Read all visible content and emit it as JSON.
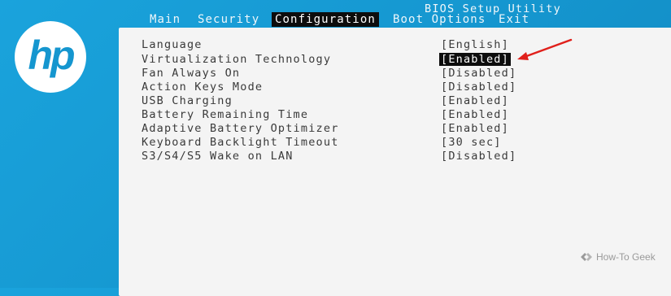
{
  "header": {
    "title": "BIOS Setup Utility"
  },
  "logo": {
    "text": "hp"
  },
  "tabs": [
    {
      "label": "Main",
      "active": false
    },
    {
      "label": "Security",
      "active": false
    },
    {
      "label": "Configuration",
      "active": true
    },
    {
      "label": "Boot Options",
      "active": false
    },
    {
      "label": "Exit",
      "active": false
    }
  ],
  "settings": [
    {
      "label": "Language",
      "value": "[English]",
      "selected": false
    },
    {
      "label": "Virtualization Technology",
      "value": "[Enabled]",
      "selected": true
    },
    {
      "label": "Fan Always On",
      "value": "[Disabled]",
      "selected": false
    },
    {
      "label": "Action Keys Mode",
      "value": "[Disabled]",
      "selected": false
    },
    {
      "label": "USB Charging",
      "value": "[Enabled]",
      "selected": false
    },
    {
      "label": "Battery Remaining Time",
      "value": "[Enabled]",
      "selected": false
    },
    {
      "label": "Adaptive Battery Optimizer",
      "value": "[Enabled]",
      "selected": false
    },
    {
      "label": "Keyboard Backlight Timeout",
      "value": "[30 sec]",
      "selected": false
    },
    {
      "label": "S3/S4/S5 Wake on LAN",
      "value": "[Disabled]",
      "selected": false
    }
  ],
  "watermark": {
    "text": "How-To Geek"
  },
  "colors": {
    "background": "#1596cf",
    "panel": "#f4f4f4",
    "highlight": "#0d0d0d",
    "arrow": "#e0201b"
  }
}
